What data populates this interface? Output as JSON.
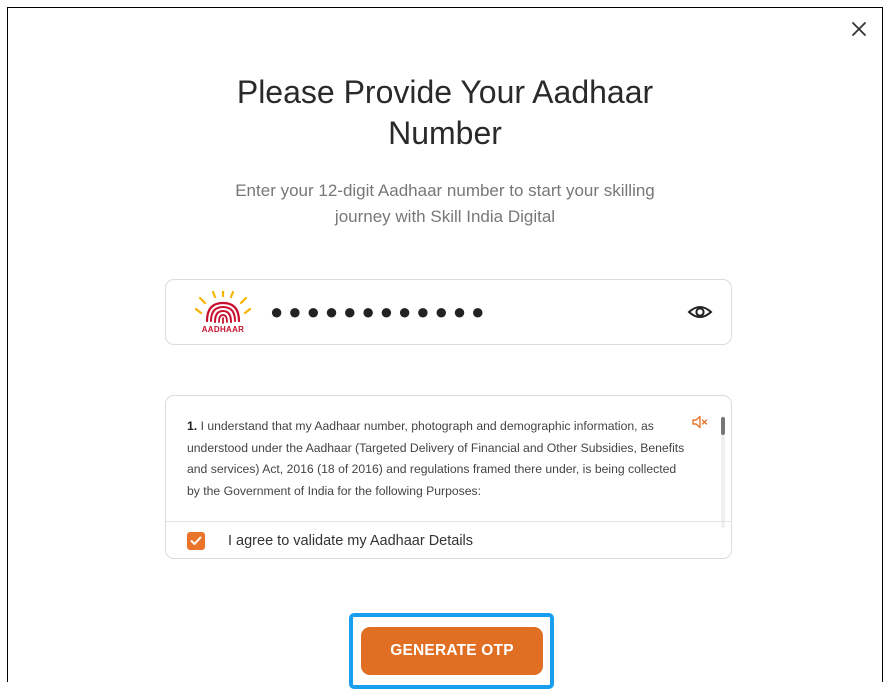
{
  "modal": {
    "title_line1": "Please Provide Your Aadhaar",
    "title_line2": "Number",
    "subtitle_line1": "Enter your 12-digit Aadhaar number to start your skilling",
    "subtitle_line2": "journey with Skill India Digital"
  },
  "aadhaar_field": {
    "logo_text": "AADHAAR",
    "masked_value": "●●●●●●●●●●●●",
    "toggle_icon": "eye-icon"
  },
  "consent": {
    "number": "1.",
    "text": "I understand that my Aadhaar number, photograph and demographic information, as understood under the Aadhaar (Targeted Delivery of Financial and Other Subsidies, Benefits and services) Act, 2016 (18 of 2016) and regulations framed there under, is being collected by the Government of India for the following Purposes:",
    "audio_icon": "speaker-mute-icon",
    "agree_label": "I agree to validate my Aadhaar Details",
    "agree_checked": true
  },
  "actions": {
    "generate_otp_label": "GENERATE OTP"
  },
  "colors": {
    "accent": "#e06f23",
    "highlight": "#1a9ef0"
  }
}
